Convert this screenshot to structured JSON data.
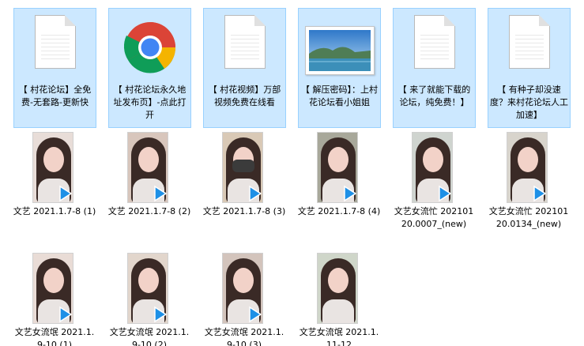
{
  "files": [
    {
      "label": "【 村花论坛】全免费-无套路-更新快",
      "icon": "text-document-icon",
      "selected": true
    },
    {
      "label": "【 村花论坛永久地址发布页】-点此打开",
      "icon": "chrome-icon",
      "selected": true
    },
    {
      "label": "【 村花视频】万部视频免费在线看",
      "icon": "text-document-icon",
      "selected": true
    },
    {
      "label": "【 解压密码】：上村花论坛看小姐姐",
      "icon": "image-icon",
      "selected": true
    },
    {
      "label": "【 来了就能下载的论坛，纯免费！】",
      "icon": "text-document-icon",
      "selected": true
    },
    {
      "label": "【 有种子却没速度？来村花论坛人工加速】",
      "icon": "text-document-icon",
      "selected": true
    }
  ],
  "videos_row1": [
    {
      "label": "文艺 2021.1.7-8 (1)",
      "bg": "#e8ddd8"
    },
    {
      "label": "文艺 2021.1.7-8 (2)",
      "bg": "#d8c6bc"
    },
    {
      "label": "文艺 2021.1.7-8 (3)",
      "bg": "#d9c9b6"
    },
    {
      "label": "文艺 2021.1.7-8 (4)",
      "bg": "#a8a89a"
    },
    {
      "label": "文艺女流忙 20210120.0007_(new)",
      "bg": "#cfd4cf"
    },
    {
      "label": "文艺女流忙 20210120.0134_(new)",
      "bg": "#d8d4cc"
    }
  ],
  "videos_row2": [
    {
      "label": "文艺女流氓 2021.1.9-10 (1)",
      "bg": "#e9dcd6"
    },
    {
      "label": "文艺女流氓 2021.1.9-10 (2)",
      "bg": "#e2d6cc"
    },
    {
      "label": "文艺女流氓 2021.1.9-10 (3)",
      "bg": "#d3c4bc"
    },
    {
      "label": "文艺女流氓 2021.1.11-12",
      "bg": "#cfd6c9"
    }
  ],
  "colors": {
    "selection": "#cce8ff",
    "selection_border": "#99d1ff",
    "play": "#1e90e6"
  }
}
